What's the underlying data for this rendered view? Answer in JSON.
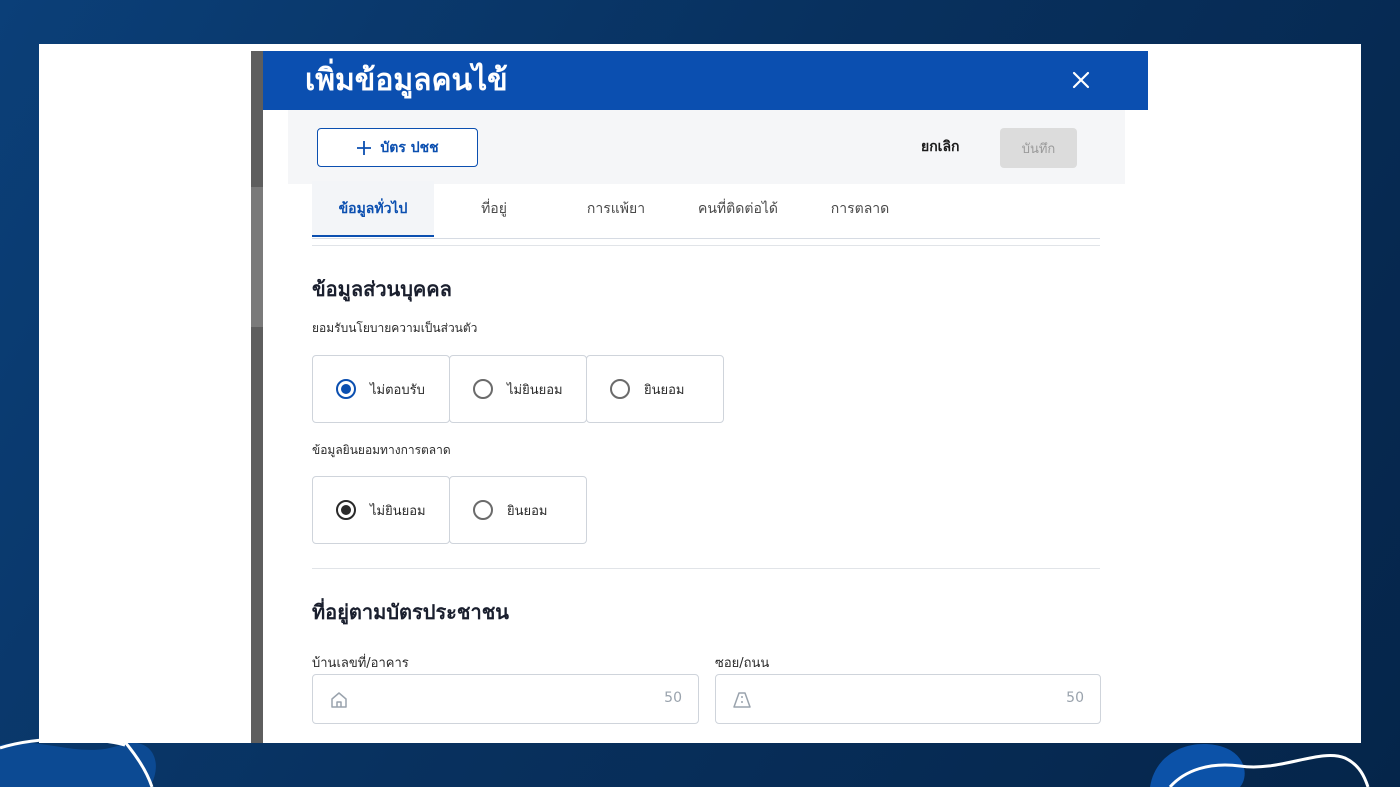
{
  "modal": {
    "title": "เพิ่มข้อมูลคนไข้",
    "close_icon": "close-icon"
  },
  "toolbar": {
    "id_card_label": "บัตร ปชช",
    "cancel_label": "ยกเลิก",
    "save_label": "บันทึก"
  },
  "tabs": [
    {
      "label": "ข้อมูลทั่วไป",
      "active": true
    },
    {
      "label": "ที่อยู่",
      "active": false
    },
    {
      "label": "การแพ้ยา",
      "active": false
    },
    {
      "label": "คนที่ติดต่อได้",
      "active": false
    },
    {
      "label": "การตลาด",
      "active": false
    }
  ],
  "personal": {
    "title": "ข้อมูลส่วนบุคคล",
    "privacy": {
      "label": "ยอมรับนโยบายความเป็นส่วนตัว",
      "options": [
        "ไม่ตอบรับ",
        "ไม่ยินยอม",
        "ยินยอม"
      ],
      "selected": "ไม่ตอบรับ"
    },
    "marketing": {
      "label": "ข้อมูลยินยอมทางการตลาด",
      "options": [
        "ไม่ยินยอม",
        "ยินยอม"
      ],
      "selected": "ไม่ยินยอม"
    }
  },
  "address": {
    "title": "ที่อยู่ตามบัตรประชาชน",
    "house": {
      "label": "บ้านเลขที่/อาคาร",
      "value": "",
      "counter": "50",
      "icon": "home-icon"
    },
    "street": {
      "label": "ซอย/ถนน",
      "value": "",
      "counter": "50",
      "icon": "road-icon"
    }
  },
  "colors": {
    "primary": "#0b4fb0",
    "background": "#08315f"
  }
}
